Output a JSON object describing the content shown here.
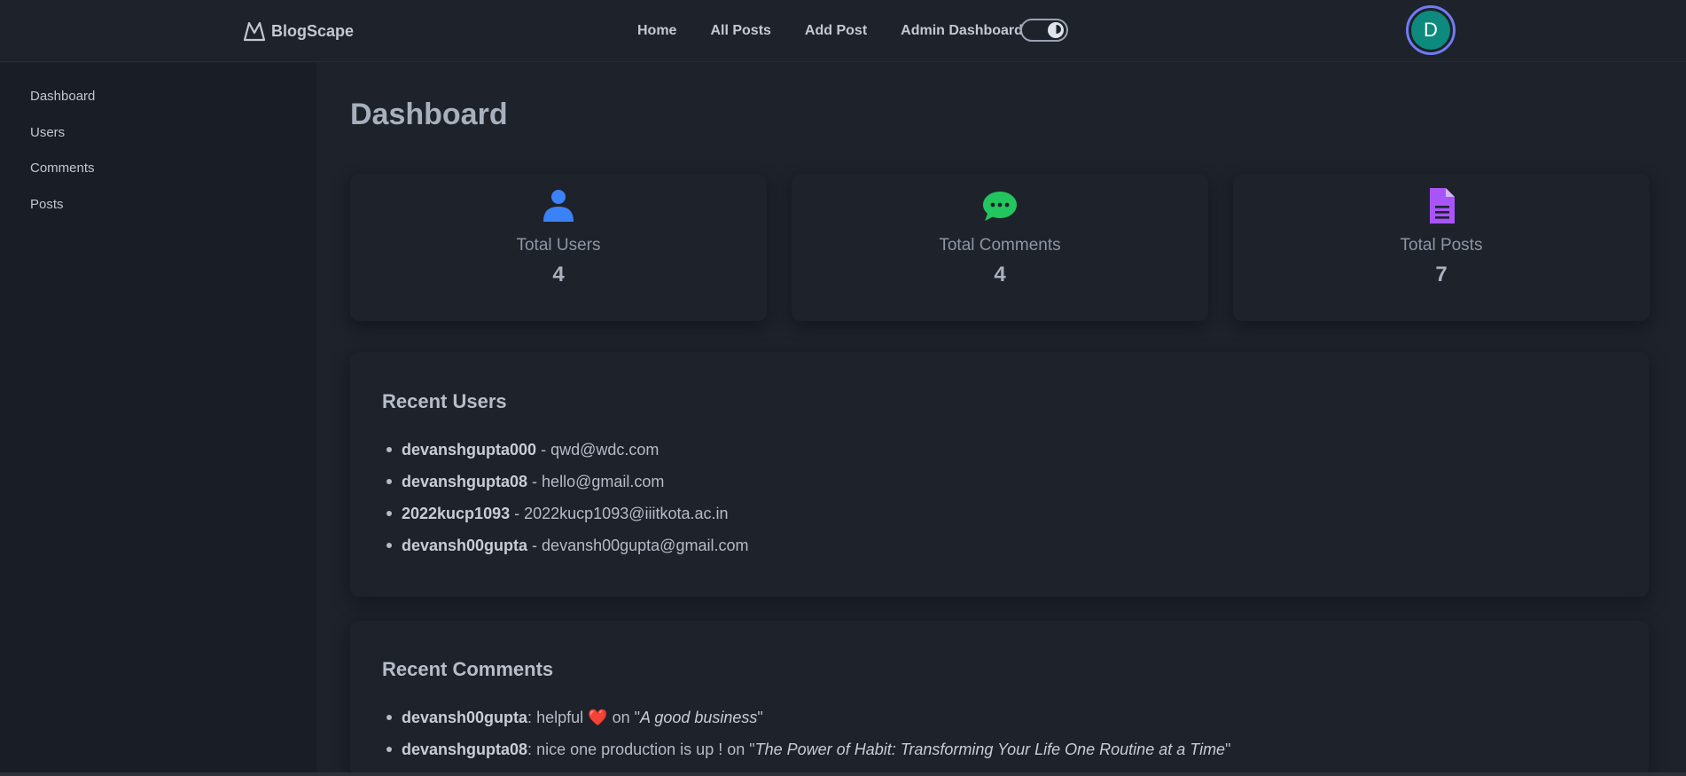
{
  "navbar": {
    "brand": "BlogScape",
    "links": [
      "Home",
      "All Posts",
      "Add Post",
      "Admin Dashboard"
    ],
    "avatar_initial": "D"
  },
  "sidebar": {
    "items": [
      "Dashboard",
      "Users",
      "Comments",
      "Posts"
    ]
  },
  "main": {
    "title": "Dashboard",
    "stats": [
      {
        "label": "Total Users",
        "value": "4",
        "icon": "user-icon",
        "color": "#3b82f6"
      },
      {
        "label": "Total Comments",
        "value": "4",
        "icon": "comment-dots-icon",
        "color": "#22c55e"
      },
      {
        "label": "Total Posts",
        "value": "7",
        "icon": "file-lines-icon",
        "color": "#a855f7"
      }
    ],
    "recent_users": {
      "title": "Recent Users",
      "items": [
        {
          "username": "devanshgupta000",
          "email": "qwd@wdc.com"
        },
        {
          "username": "devanshgupta08",
          "email": "hello@gmail.com"
        },
        {
          "username": "2022kucp1093",
          "email": "2022kucp1093@iiitkota.ac.in"
        },
        {
          "username": "devansh00gupta",
          "email": "devansh00gupta@gmail.com"
        }
      ]
    },
    "recent_comments": {
      "title": "Recent Comments",
      "items": [
        {
          "username": "devansh00gupta",
          "text": "helpful",
          "emoji": "❤️",
          "on": "on \"",
          "post": "A good business",
          "close": "\""
        },
        {
          "username": "devanshgupta08",
          "text": "nice one production is up !",
          "emoji": "",
          "on": "on \"",
          "post": "The Power of Habit: Transforming Your Life One Routine at a Time",
          "close": "\""
        }
      ]
    }
  }
}
